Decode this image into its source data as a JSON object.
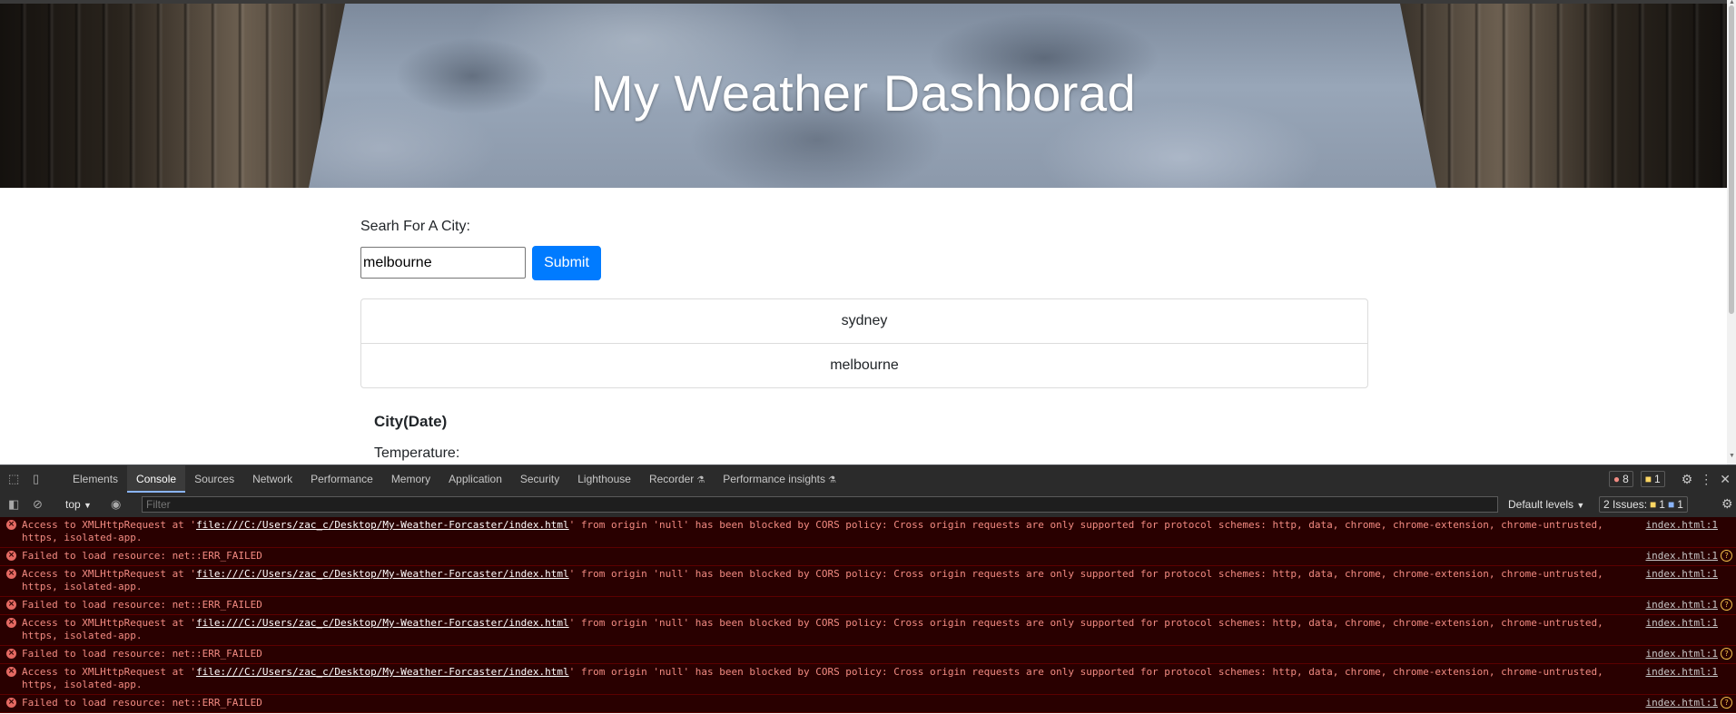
{
  "page": {
    "hero_title": "My Weather Dashborad",
    "search_label": "Searh For A City:",
    "search_value": "melbourne",
    "submit_label": "Submit",
    "history": [
      "sydney",
      "melbourne"
    ],
    "city_heading": "City(Date)",
    "temperature_label": "Temperature:"
  },
  "devtools": {
    "tabs": [
      "Elements",
      "Console",
      "Sources",
      "Network",
      "Performance",
      "Memory",
      "Application",
      "Security",
      "Lighthouse",
      "Recorder",
      "Performance insights"
    ],
    "active_tab": "Console",
    "error_count": "8",
    "warning_count": "1",
    "context": "top",
    "filter_placeholder": "Filter",
    "levels": "Default levels",
    "issues_label": "2 Issues:",
    "issues_warn": "1",
    "issues_info": "1",
    "messages": [
      {
        "pre": "Access to XMLHttpRequest at '",
        "url": "file:///C:/Users/zac_c/Desktop/My-Weather-Forcaster/index.html",
        "post": "' from origin 'null' has been blocked by CORS policy: Cross origin requests are only supported for protocol schemes: http, data, chrome, chrome-extension, chrome-untrusted, https, isolated-app.",
        "source": "index.html:1"
      },
      {
        "pre": "Failed to load resource: net::ERR_FAILED",
        "url": "",
        "post": "",
        "source": "index.html:1"
      },
      {
        "pre": "Access to XMLHttpRequest at '",
        "url": "file:///C:/Users/zac_c/Desktop/My-Weather-Forcaster/index.html",
        "post": "' from origin 'null' has been blocked by CORS policy: Cross origin requests are only supported for protocol schemes: http, data, chrome, chrome-extension, chrome-untrusted, https, isolated-app.",
        "source": "index.html:1"
      },
      {
        "pre": "Failed to load resource: net::ERR_FAILED",
        "url": "",
        "post": "",
        "source": "index.html:1"
      },
      {
        "pre": "Access to XMLHttpRequest at '",
        "url": "file:///C:/Users/zac_c/Desktop/My-Weather-Forcaster/index.html",
        "post": "' from origin 'null' has been blocked by CORS policy: Cross origin requests are only supported for protocol schemes: http, data, chrome, chrome-extension, chrome-untrusted, https, isolated-app.",
        "source": "index.html:1"
      },
      {
        "pre": "Failed to load resource: net::ERR_FAILED",
        "url": "",
        "post": "",
        "source": "index.html:1"
      },
      {
        "pre": "Access to XMLHttpRequest at '",
        "url": "file:///C:/Users/zac_c/Desktop/My-Weather-Forcaster/index.html",
        "post": "' from origin 'null' has been blocked by CORS policy: Cross origin requests are only supported for protocol schemes: http, data, chrome, chrome-extension, chrome-untrusted, https, isolated-app.",
        "source": "index.html:1"
      },
      {
        "pre": "Failed to load resource: net::ERR_FAILED",
        "url": "",
        "post": "",
        "source": "index.html:1"
      }
    ]
  },
  "colors": {
    "submit": "#007bff",
    "error_bg": "#290000",
    "error_text": "#f28b82",
    "devtools_bg": "#242424"
  }
}
